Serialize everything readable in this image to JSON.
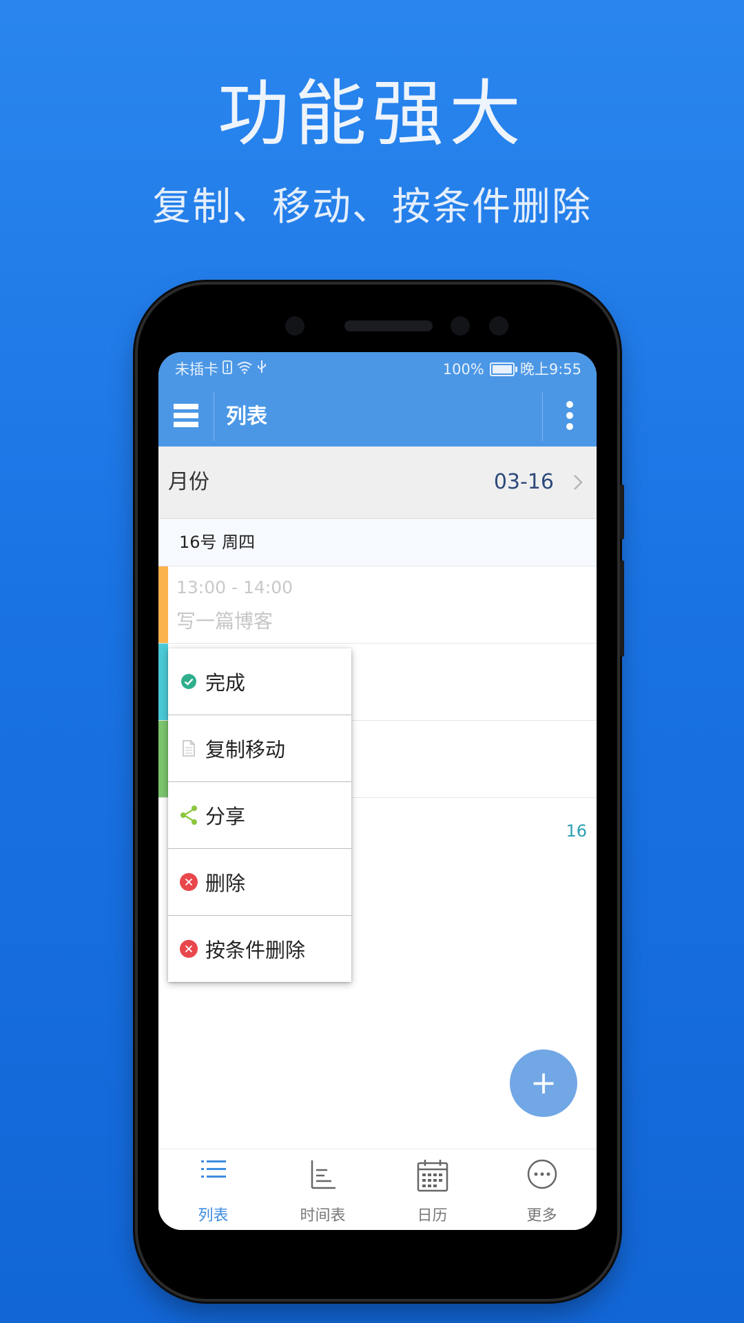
{
  "promo": {
    "title": "功能强大",
    "subtitle": "复制、移动、按条件删除"
  },
  "status_bar": {
    "carrier": "未插卡",
    "battery_percent": "100%",
    "time": "晚上9:55"
  },
  "app_bar": {
    "title": "列表"
  },
  "month_row": {
    "label": "月份",
    "value": "03-16"
  },
  "day_header": {
    "label": "16号 周四"
  },
  "events": [
    {
      "time": "13:00 - 14:00",
      "title": "写一篇博客",
      "color": "#fbb24a"
    },
    {
      "color": "#4bc9d6"
    },
    {
      "color": "#7cc56d"
    }
  ],
  "date_number": "16",
  "context_menu": {
    "items": [
      {
        "label": "完成",
        "icon": "check-circle-icon"
      },
      {
        "label": "复制移动",
        "icon": "document-icon"
      },
      {
        "label": "分享",
        "icon": "share-icon"
      },
      {
        "label": "删除",
        "icon": "delete-circle-icon"
      },
      {
        "label": "按条件删除",
        "icon": "delete-circle-icon"
      }
    ]
  },
  "fab": {
    "label": "+"
  },
  "bottom_nav": {
    "items": [
      {
        "label": "列表",
        "icon": "list-icon",
        "active": true
      },
      {
        "label": "时间表",
        "icon": "timeline-icon",
        "active": false
      },
      {
        "label": "日历",
        "icon": "calendar-icon",
        "active": false
      },
      {
        "label": "更多",
        "icon": "more-circle-icon",
        "active": false
      }
    ]
  },
  "colors": {
    "accent": "#4b97e6",
    "background_gradient_top": "#2a86ee",
    "active_nav": "#3c8ce0"
  }
}
